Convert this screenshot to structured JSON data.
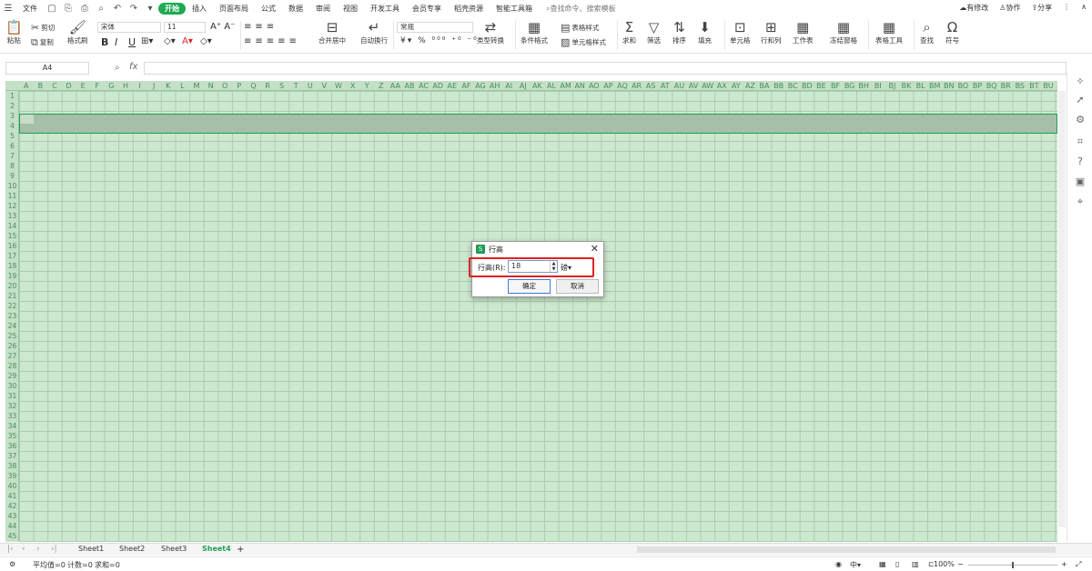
{
  "menubar": {
    "file": "文件",
    "tabs": [
      "开始",
      "插入",
      "页面布局",
      "公式",
      "数据",
      "审阅",
      "视图",
      "开发工具",
      "会员专享",
      "稻壳资源",
      "智能工具箱"
    ],
    "search_placeholder": "查找命令、搜索模板",
    "right": {
      "modify": "有修改",
      "collab": "协作",
      "share": "分享"
    }
  },
  "ribbon": {
    "paste": "粘贴",
    "cut": "剪切",
    "copy": "复制",
    "format_painter": "格式刷",
    "font_name": "宋体",
    "font_size": "11",
    "bold": "B",
    "italic": "I",
    "underline": "U",
    "merge_center": "合并居中",
    "wrap_text": "自动换行",
    "number_format": "常规",
    "type_convert": "类型转换",
    "cond_format": "条件格式",
    "table_style": "表格样式",
    "cell_style": "单元格样式",
    "sum": "求和",
    "filter": "筛选",
    "sort": "排序",
    "fill": "填充",
    "cell": "单元格",
    "row_col": "行和列",
    "worksheet": "工作表",
    "freeze": "冻结窗格",
    "table_tools": "表格工具",
    "find": "查找",
    "symbol": "符号"
  },
  "formula": {
    "namebox": "A4",
    "fx": "fx"
  },
  "columns": [
    "A",
    "B",
    "C",
    "D",
    "E",
    "F",
    "G",
    "H",
    "I",
    "J",
    "K",
    "L",
    "M",
    "N",
    "O",
    "P",
    "Q",
    "R",
    "S",
    "T",
    "U",
    "V",
    "W",
    "X",
    "Y",
    "Z",
    "AA",
    "AB",
    "AC",
    "AD",
    "AE",
    "AF",
    "AG",
    "AH",
    "AI",
    "AJ",
    "AK",
    "AL",
    "AM",
    "AN",
    "AO",
    "AP",
    "AQ",
    "AR",
    "AS",
    "AT",
    "AU",
    "AV",
    "AW",
    "AX",
    "AY",
    "AZ",
    "BA",
    "BB",
    "BC",
    "BD",
    "BE",
    "BF",
    "BG",
    "BH",
    "BI",
    "BJ",
    "BK",
    "BL",
    "BM",
    "BN",
    "BO",
    "BP",
    "BQ",
    "BR",
    "BS",
    "BT",
    "BU"
  ],
  "rows": [
    "1",
    "2",
    "3",
    "4",
    "5",
    "6",
    "7",
    "8",
    "9",
    "10",
    "11",
    "12",
    "13",
    "14",
    "15",
    "16",
    "17",
    "18",
    "19",
    "20",
    "21",
    "22",
    "23",
    "24",
    "25",
    "26",
    "27",
    "28",
    "29",
    "30",
    "31",
    "32",
    "33",
    "34",
    "35",
    "36",
    "37",
    "38",
    "39",
    "40",
    "41",
    "42",
    "43",
    "44",
    "45"
  ],
  "sheets": {
    "tabs": [
      "Sheet1",
      "Sheet2",
      "Sheet3",
      "Sheet4"
    ],
    "active": "Sheet4"
  },
  "status": {
    "avg": "平均值=0",
    "count": "计数=0",
    "sum": "求和=0",
    "zoom": "100%"
  },
  "dialog": {
    "title": "行高",
    "label": "行高(R):",
    "value": "18",
    "unit": "磅▾",
    "ok": "确定",
    "cancel": "取消"
  },
  "colors": {
    "accent": "#1f9d55",
    "grid_bg": "#cce8cf",
    "highlight": "#e02020"
  }
}
